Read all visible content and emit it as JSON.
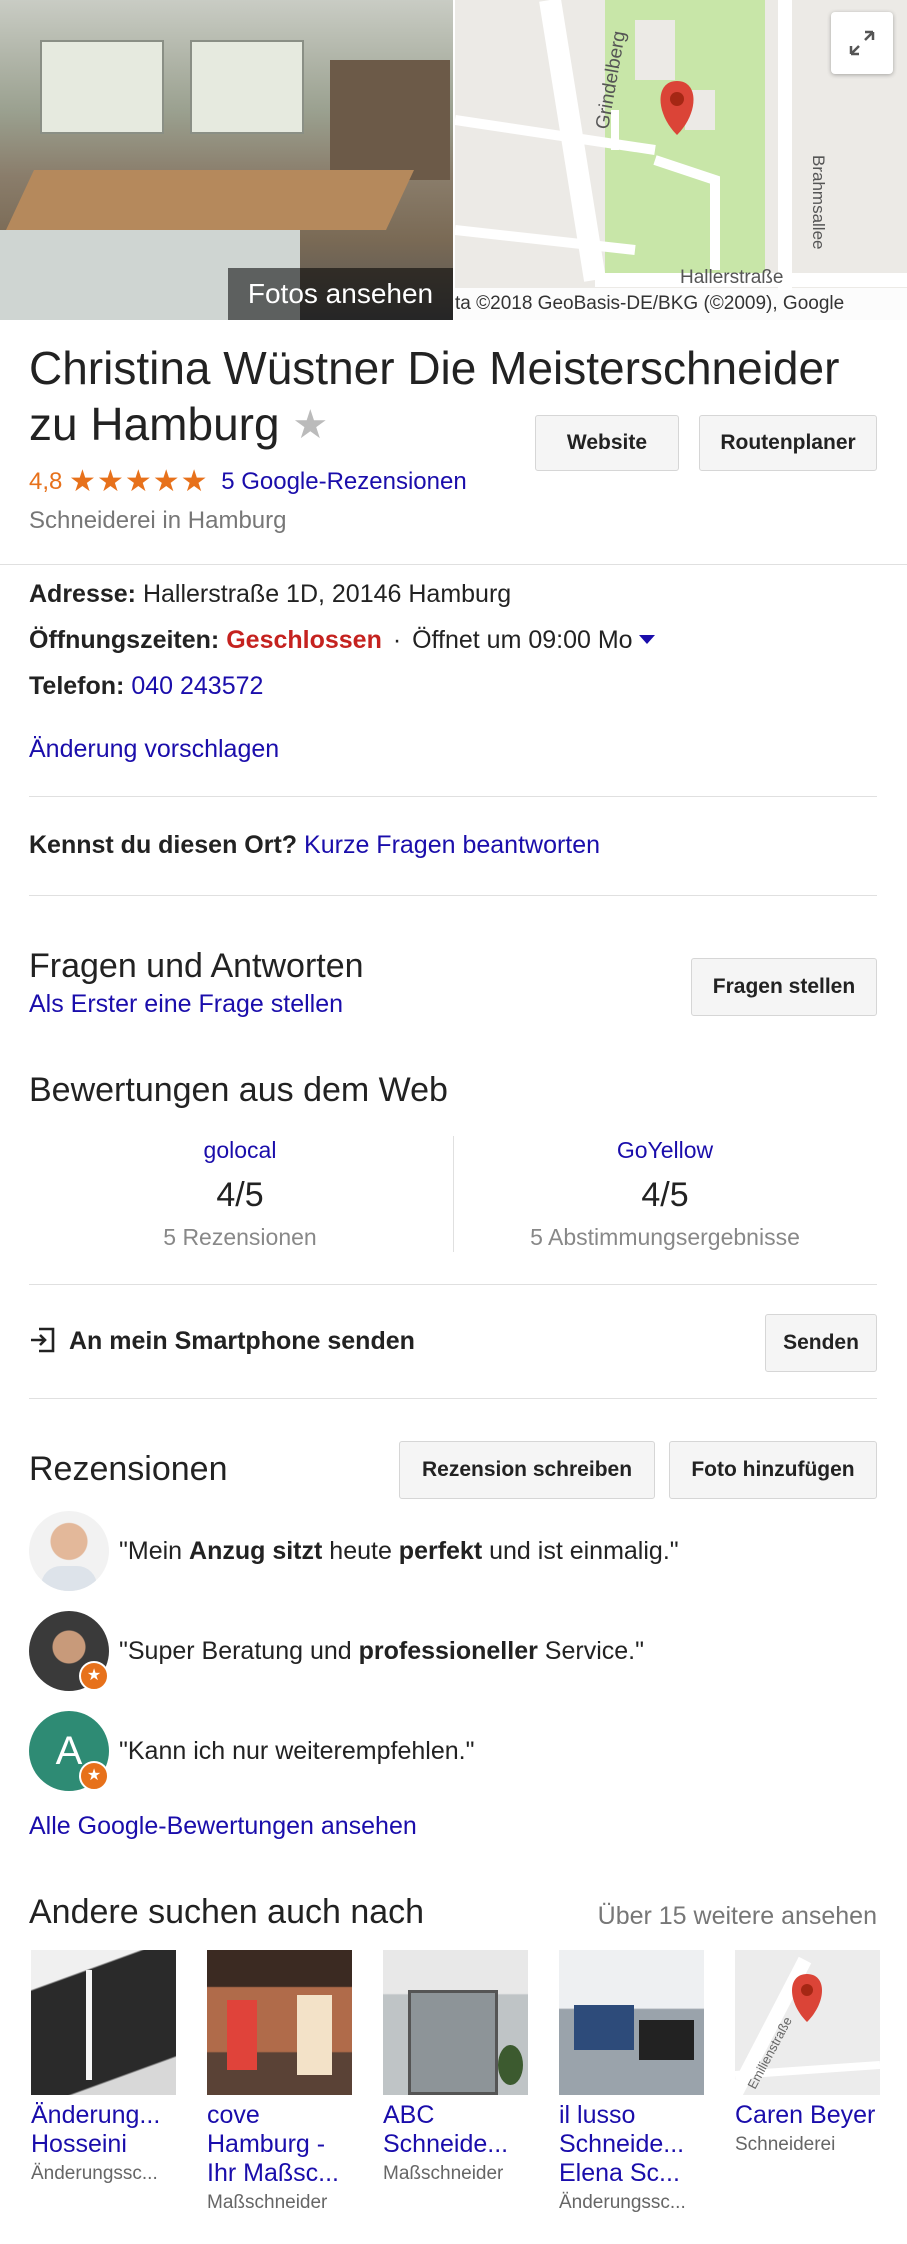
{
  "media": {
    "photo_caption": "Fotos ansehen",
    "map_credit": "ta ©2018 GeoBasis-DE/BKG (©2009), Google",
    "map_labels": {
      "street1": "Grindelberg",
      "street2": "Hallerstraße",
      "street3": "Brahmsallee"
    },
    "expand_icon": "expand-icon"
  },
  "header": {
    "title_line1": "Christina Wüstner Die Meisterschneider",
    "title_line2": "zu Hamburg",
    "rating": "4,8",
    "stars": "★★★★★",
    "reviews_link": "5 Google-Rezensionen",
    "category": "Schneiderei in Hamburg",
    "website_button": "Website",
    "route_button": "Routenplaner"
  },
  "info": {
    "address_label": "Adresse:",
    "address_value": "Hallerstraße 1D, 20146 Hamburg",
    "hours_label": "Öffnungszeiten:",
    "hours_status": "Geschlossen",
    "hours_sep": "·",
    "hours_next": "Öffnet um 09:00 Mo",
    "phone_label": "Telefon:",
    "phone_value": "040 243572",
    "suggest_edit": "Änderung vorschlagen"
  },
  "know_place": {
    "question": "Kennst du diesen Ort?",
    "link": "Kurze Fragen beantworten"
  },
  "qa": {
    "title": "Fragen und Antworten",
    "subtitle_link": "Als Erster eine Frage stellen",
    "button": "Fragen stellen"
  },
  "web_reviews": {
    "title": "Bewertungen aus dem Web",
    "sources": [
      {
        "name": "golocal",
        "score": "4/5",
        "count": "5 Rezensionen"
      },
      {
        "name": "GoYellow",
        "score": "4/5",
        "count": "5 Abstimmungsergebnisse"
      }
    ]
  },
  "send": {
    "label": "An mein Smartphone senden",
    "button": "Senden"
  },
  "reviews": {
    "title": "Rezensionen",
    "write_button": "Rezension schreiben",
    "photo_button": "Foto hinzufügen",
    "items": [
      {
        "q1": "\"Mein ",
        "b1": "Anzug sitzt",
        "t1": " heute ",
        "b2": "perfekt",
        "t2": " und ist einmalig.\""
      },
      {
        "q1": "\"Super Beratung und ",
        "b1": "professioneller",
        "t1": " Service.\""
      },
      {
        "q1": "\"Kann ich nur weiterempfehlen.\"",
        "initial": "A"
      }
    ],
    "all_link": "Alle Google-Bewertungen ansehen"
  },
  "also_searched": {
    "title": "Andere suchen auch nach",
    "more_link": "Über 15 weitere ansehen",
    "cards": [
      {
        "name": "Änderung... Hosseini",
        "category": "Änderungssc..."
      },
      {
        "name": "cove Hamburg - Ihr Maßsc...",
        "category": "Maßschneider"
      },
      {
        "name": "ABC Schneide...",
        "category": "Maßschneider"
      },
      {
        "name": "il lusso Schneide... Elena Sc...",
        "category": "Änderungssc..."
      },
      {
        "name": "Caren Beyer",
        "category": "Schneiderei",
        "map_street": "Emilienstraße"
      }
    ]
  },
  "colors": {
    "link": "#1a0dab",
    "star": "#e7711b",
    "closed": "#c5221f"
  }
}
